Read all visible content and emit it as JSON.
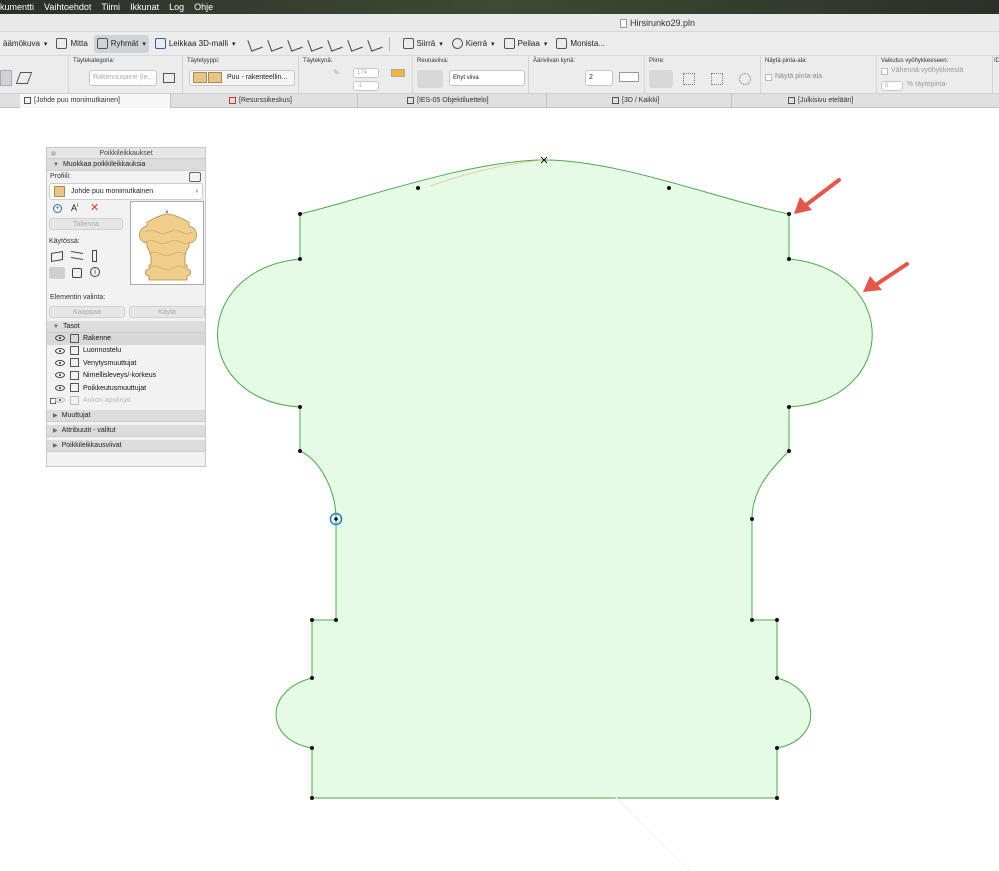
{
  "menubar": {
    "items": [
      "kumentti",
      "Vaihtoehdot",
      "Tiimi",
      "Ikkunat",
      "Log",
      "Ohje"
    ]
  },
  "window": {
    "title": "Hirsirunko29.pln"
  },
  "toolbar": {
    "items": [
      {
        "label": "äämökuva"
      },
      {
        "label": "Mitta"
      },
      {
        "label": "Ryhmät"
      },
      {
        "label": "Leikkaa 3D-malli"
      },
      {
        "label": "Siirrä"
      },
      {
        "label": "Kierrä"
      },
      {
        "label": "Peilaa"
      },
      {
        "label": "Monista..."
      }
    ]
  },
  "infobox": {
    "fill_category_label": "Täytekategoria:",
    "fill_category_value": "Rakennusaine (le...",
    "fill_type_label": "Täytetyyppi:",
    "fill_type_value": "Puu - rakenteellin...",
    "fill_pen_label": "Täytekynä:",
    "fill_pen_value_1": "174",
    "fill_pen_value_2": "-1",
    "edge_line_label": "Reunaviiva:",
    "edge_line_value": "Ehyt viiva",
    "outline_pen_label": "Ääriviivan kynä:",
    "outline_pen_value": "2",
    "scribe_label": "Piirre:",
    "show_area_label": "Näytä pinta-ala:",
    "show_area_checkbox": "Näytä pinta-ala",
    "zone_effect_label": "Vaikutus vyöhykkeeseen:",
    "zone_reduce": "Vähennä vyöhykkeestä",
    "zone_percent_value": "0",
    "zone_percent_unit": "% täytepinta-",
    "id_label": "ID"
  },
  "tabs": [
    {
      "label": "[Johde puu monimutkainen]"
    },
    {
      "label": "[Resurssikeskus]"
    },
    {
      "label": "[IES-05 Objektiluettelo]"
    },
    {
      "label": "[3D / Kaikki]"
    },
    {
      "label": "[Julkisivu etelään]"
    }
  ],
  "panel": {
    "title": "Poikkileikkaukset",
    "edit_section": "Muokkaa poikkileikkauksia",
    "profile_label": "Profiili:",
    "profile_name": "Johde puu monimutkainen",
    "save_button": "Tallenna",
    "usage_label": "Käytössä:",
    "selection_label": "Elementin valinta:",
    "capture_button": "Kaappaa",
    "apply_button": "Käytä",
    "layers_section": "Tasot",
    "layers": [
      {
        "label": "Rakenne",
        "selected": true,
        "visible": true
      },
      {
        "label": "Luonnostelu",
        "selected": false,
        "visible": true
      },
      {
        "label": "Venytysmuuttujat",
        "selected": false,
        "visible": true
      },
      {
        "label": "Nimellisleveys/-korkeus",
        "selected": false,
        "visible": true
      },
      {
        "label": "Poikkeutusmuuttujat",
        "selected": false,
        "visible": true
      },
      {
        "label": "Aukon apulinjat",
        "selected": false,
        "visible": false
      }
    ],
    "collapsed_sections": [
      "Muuttujat",
      "Attribuutit - valitut",
      "Poikkileikkausviivat"
    ]
  },
  "colors": {
    "profile_fill": "#e6fbe6",
    "profile_stroke": "#4caa4c",
    "arrow": "#e5564a",
    "vertex": "#111111",
    "selected_vertex": "#1a7fd0"
  }
}
